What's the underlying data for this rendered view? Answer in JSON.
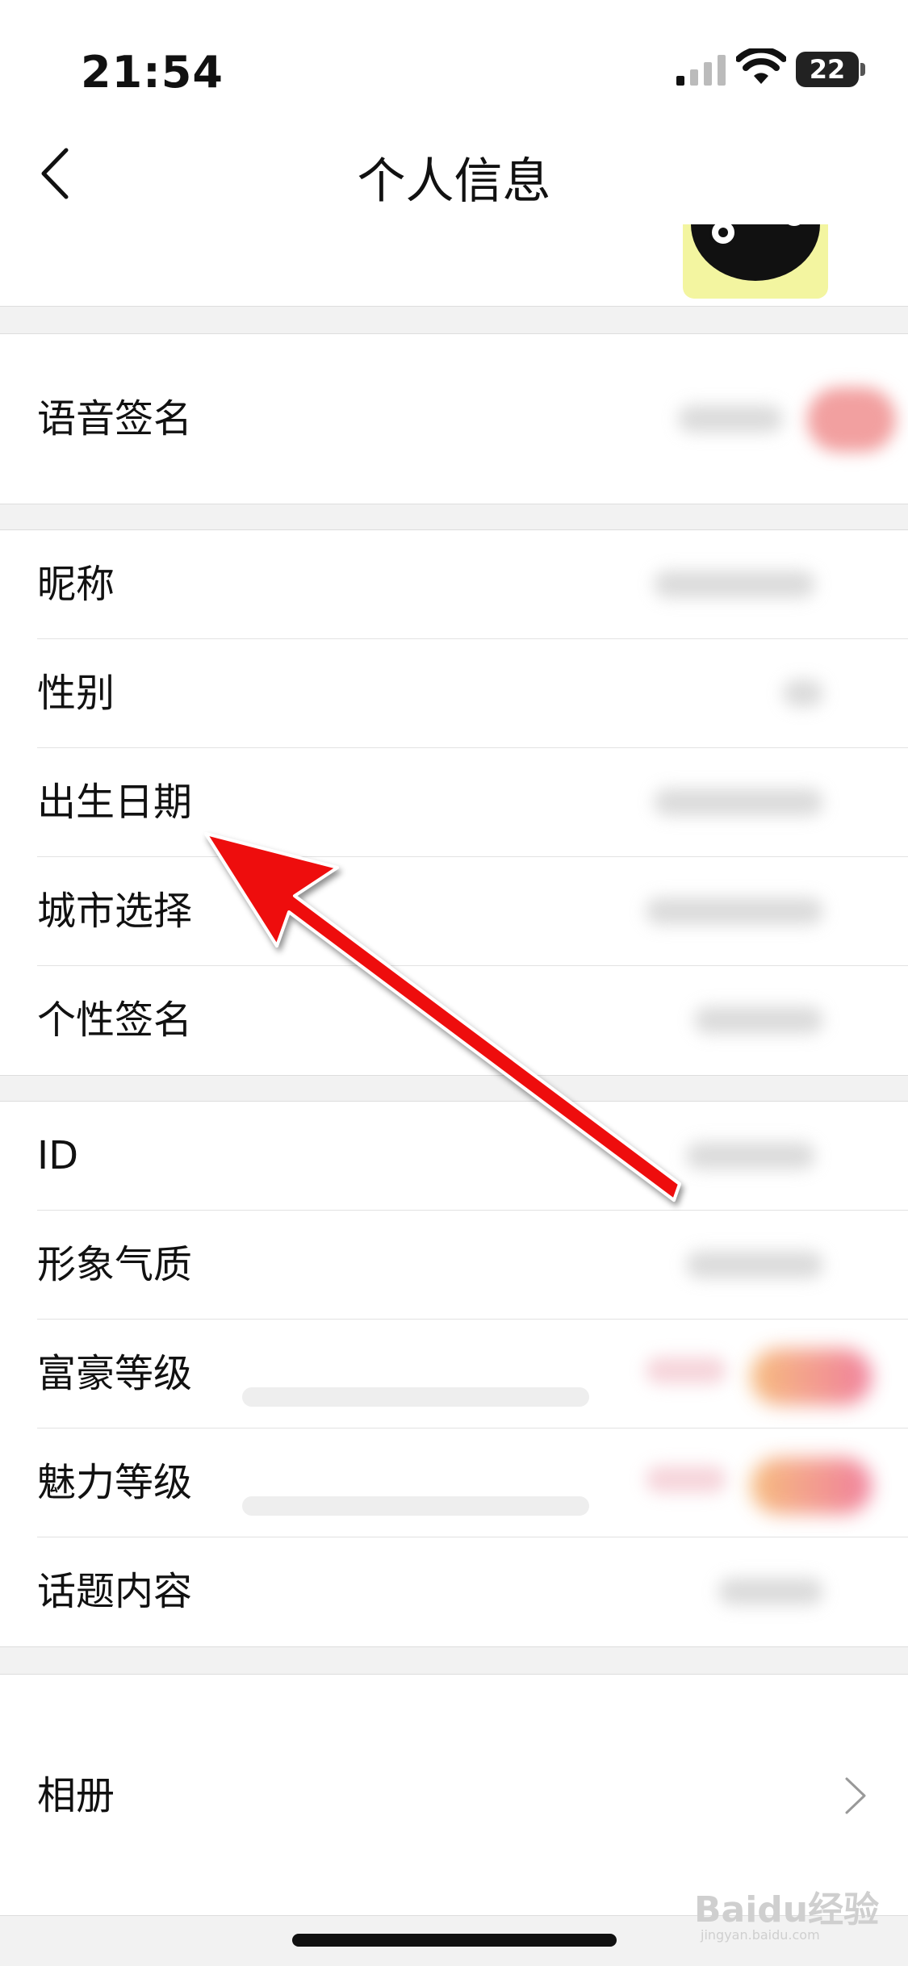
{
  "status_bar": {
    "time": "21:54",
    "battery": "22",
    "icons": [
      "signal-icon",
      "wifi-icon",
      "battery-icon"
    ]
  },
  "nav": {
    "title": "个人信息",
    "back_icon": "chevron-left-icon"
  },
  "voice_section": {
    "label": "语音签名"
  },
  "profile_section": {
    "items": [
      {
        "label": "昵称"
      },
      {
        "label": "性别"
      },
      {
        "label": "出生日期"
      },
      {
        "label": "城市选择"
      },
      {
        "label": "个性签名"
      }
    ]
  },
  "detail_section": {
    "items": [
      {
        "label": "ID"
      },
      {
        "label": "形象气质"
      },
      {
        "label": "富豪等级"
      },
      {
        "label": "魅力等级"
      },
      {
        "label": "话题内容"
      }
    ]
  },
  "album_section": {
    "label": "相册",
    "chevron_icon": "chevron-right-icon"
  },
  "annotation": {
    "color": "#ee1111",
    "points_to": "出生日期"
  },
  "watermark": {
    "text": "Baidu经验",
    "sub": "jingyan.baidu.com"
  }
}
